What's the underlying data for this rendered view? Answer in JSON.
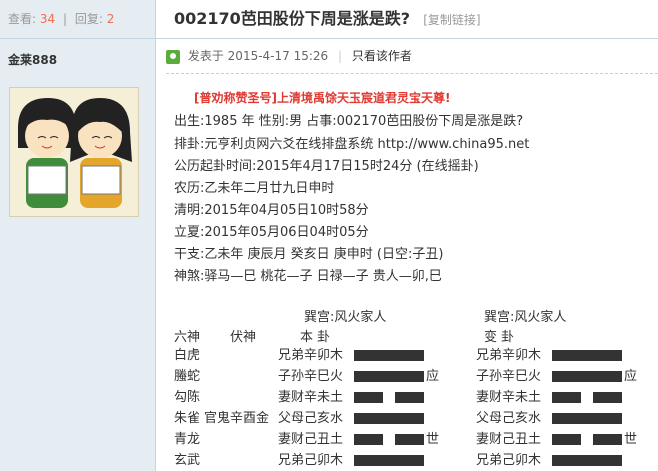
{
  "sidebar": {
    "views_label": "查看:",
    "views": "34",
    "separator": "|",
    "replies_label": "回复:",
    "replies": "2",
    "username": "金莱888"
  },
  "thread": {
    "title": "002170芭田股份下周是涨是跌?",
    "copy_link": "[复制链接]"
  },
  "post": {
    "posted_label": "发表于",
    "posted_time": "2015-4-17 15:26",
    "separator": "|",
    "only_author": "只看该作者"
  },
  "content": {
    "ad": "[普劝称赞圣号]上清境禹馀天玉宸道君灵宝天尊!",
    "lines": [
      "出生:1985 年   性别:男   占事:002170芭田股份下周是涨是跌?",
      "排卦:元亨利贞网六爻在线排盘系统          http://www.china95.net",
      "公历起卦时间:2015年4月17日15时24分    (在线摇卦)",
      "农历:乙未年二月廿九日申时",
      "清明:2015年04月05日10时58分",
      "立夏:2015年05月06日04时05分",
      "干支:乙未年   庚辰月   癸亥日   庚申时        (日空:子丑)",
      "神煞:驿马—巳   桃花—子   日禄—子   贵人—卯,巳"
    ],
    "gua_header": {
      "left_palace": "巽宫:风火家人",
      "right_palace": "巽宫:风火家人",
      "col_liushen": "六神",
      "col_fushen": "伏神",
      "col_ben": "本          卦",
      "col_bian": "变          卦"
    },
    "rows": [
      {
        "liushen": "白虎",
        "fushen": "",
        "ben": "兄弟辛卯木",
        "ben_solid": true,
        "ben_mark": "",
        "bian": "兄弟辛卯木",
        "bian_solid": true,
        "bian_mark": ""
      },
      {
        "liushen": "螣蛇",
        "fushen": "",
        "ben": "子孙辛巳火",
        "ben_solid": true,
        "ben_mark": "应",
        "bian": "子孙辛巳火",
        "bian_solid": true,
        "bian_mark": "应"
      },
      {
        "liushen": "勾陈",
        "fushen": "",
        "ben": "妻财辛未土",
        "ben_solid": false,
        "ben_mark": "",
        "bian": "妻财辛未土",
        "bian_solid": false,
        "bian_mark": ""
      },
      {
        "liushen": "朱雀",
        "fushen": "官鬼辛酉金",
        "ben": "父母己亥水",
        "ben_solid": true,
        "ben_mark": "",
        "bian": "父母己亥水",
        "bian_solid": true,
        "bian_mark": ""
      },
      {
        "liushen": "青龙",
        "fushen": "",
        "ben": "妻财己丑土",
        "ben_solid": false,
        "ben_mark": "世",
        "bian": "妻财己丑土",
        "bian_solid": false,
        "bian_mark": "世"
      },
      {
        "liushen": "玄武",
        "fushen": "",
        "ben": "兄弟己卯木",
        "ben_solid": true,
        "ben_mark": "",
        "bian": "兄弟己卯木",
        "bian_solid": true,
        "bian_mark": ""
      }
    ]
  },
  "colors": {
    "accent_red": "#e03a32",
    "stat_orange": "#f26c4f",
    "sidebar_bg": "#e5edf2",
    "border": "#c2d5e3"
  }
}
